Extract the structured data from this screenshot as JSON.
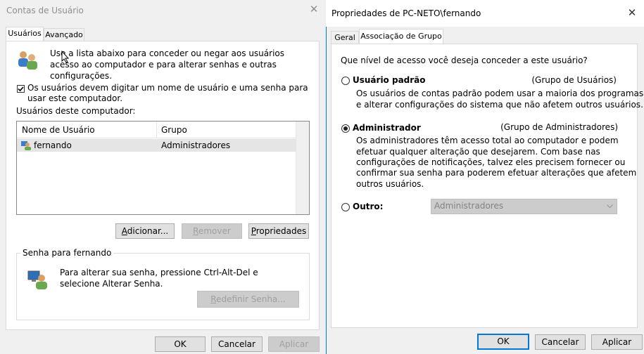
{
  "left": {
    "title": "Contas de Usuário",
    "tabs": [
      "Usuários",
      "Avançado"
    ],
    "intro": "Use a lista abaixo para conceder ou negar aos usuários acesso ao computador e para alterar senhas e outras configurações.",
    "checkbox_label": "Os usuários devem digitar um nome de usuário e uma senha para usar este computador.",
    "users_label": "Usuários deste computador:",
    "columns": [
      "Nome de Usuário",
      "Grupo"
    ],
    "rows": [
      {
        "name": "fernando",
        "group": "Administradores"
      }
    ],
    "buttons": {
      "add": "Adicionar...",
      "remove": "Remover",
      "properties": "Propriedades"
    },
    "password_group": "Senha para fernando",
    "password_text": "Para alterar sua senha, pressione Ctrl-Alt-Del e selecione Alterar Senha.",
    "reset_button": "Redefinir Senha...",
    "ok": "OK",
    "cancel": "Cancelar",
    "apply": "Aplicar"
  },
  "right": {
    "title": "Propriedades de PC-NETO\\fernando",
    "tabs": [
      "Geral",
      "Associação de Grupo"
    ],
    "question": "Que nível de acesso você deseja conceder a este usuário?",
    "standard": {
      "label": "Usuário padrão",
      "group": "(Grupo de Usuários)",
      "desc1": "Os usuários de contas padrão podem usar a maioria dos programas",
      "desc2": "e alterar configurações do sistema que não afetem outros usuários."
    },
    "admin": {
      "label": "Administrador",
      "group": "(Grupo de Administradores)",
      "desc1": "Os administradores têm acesso total ao computador e podem",
      "desc2": "efetuar qualquer alteração que desejarem. Com base nas",
      "desc3": "configurações de notificações, talvez eles precisem fornecer ou",
      "desc4": "confirmar sua senha para poderem efetuar alterações que afetem",
      "desc5": "outros usuários."
    },
    "other": {
      "label": "Outro:",
      "value": "Administradores"
    },
    "ok": "OK",
    "cancel": "Cancelar",
    "apply": "Aplicar"
  }
}
